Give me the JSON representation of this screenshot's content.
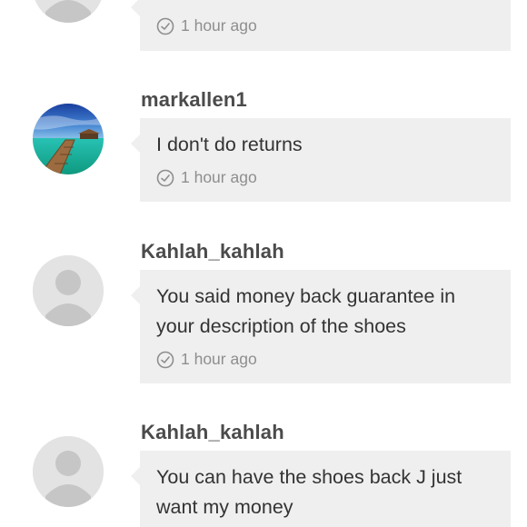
{
  "comments": [
    {
      "username": "",
      "message": "",
      "time": "1 hour ago",
      "avatar": "person-silhouette-icon"
    },
    {
      "username": "markallen1",
      "message": "I don't do returns",
      "time": "1 hour ago",
      "avatar": "tropical-pier-photo"
    },
    {
      "username": "Kahlah_kahlah",
      "message": "You said money back guarantee in your description of the shoes",
      "time": "1 hour ago",
      "avatar": "person-silhouette-icon"
    },
    {
      "username": "Kahlah_kahlah",
      "message": "You can have the shoes back J just want my money",
      "time": "",
      "avatar": "person-silhouette-icon"
    }
  ],
  "colors": {
    "bubble": "#efefef",
    "username": "#4b4b4b",
    "message": "#333333",
    "timestamp": "#8e8e8e",
    "avatar_placeholder": "#e3e3e3"
  }
}
